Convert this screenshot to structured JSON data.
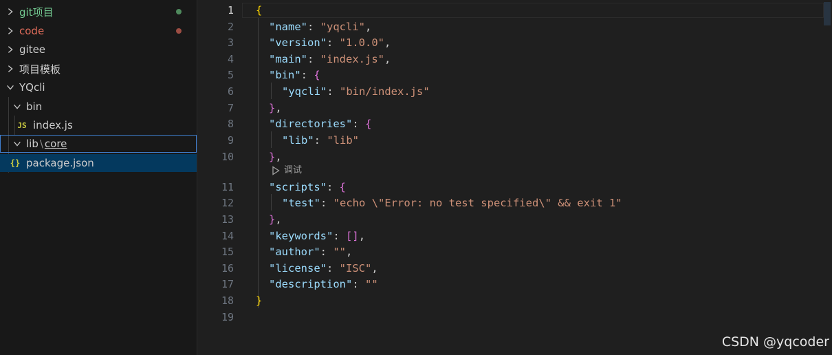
{
  "explorer": {
    "items": [
      {
        "label": "git项目",
        "color": "#73c991",
        "badge_color": "#4f8a5d",
        "expanded": false
      },
      {
        "label": "code",
        "color": "#e06c5a",
        "badge_color": "#9c4d43",
        "expanded": false
      },
      {
        "label": "gitee",
        "expanded": false
      },
      {
        "label": "项目模板",
        "expanded": false
      },
      {
        "label": "YQcli",
        "expanded": true
      },
      {
        "label": "bin",
        "expanded": true
      },
      {
        "label": "index.js",
        "icon": "JS"
      },
      {
        "label_left": "lib",
        "separator": "\\",
        "label_right": "core",
        "expanded": true
      },
      {
        "label": "package.json",
        "icon": "{}"
      }
    ]
  },
  "editor": {
    "line_numbers": [
      "1",
      "2",
      "3",
      "4",
      "5",
      "6",
      "7",
      "8",
      "9",
      "10",
      "11",
      "12",
      "13",
      "14",
      "15",
      "16",
      "17",
      "18",
      "19"
    ],
    "codelens": "调试",
    "lines": {
      "l1": {
        "open": "{"
      },
      "l2": {
        "key": "\"name\"",
        "colon": ": ",
        "value": "\"yqcli\"",
        "comma": ","
      },
      "l3": {
        "key": "\"version\"",
        "colon": ": ",
        "value": "\"1.0.0\"",
        "comma": ","
      },
      "l4": {
        "key": "\"main\"",
        "colon": ": ",
        "value": "\"index.js\"",
        "comma": ","
      },
      "l5": {
        "key": "\"bin\"",
        "colon": ": ",
        "open": "{"
      },
      "l6": {
        "key": "\"yqcli\"",
        "colon": ": ",
        "value": "\"bin/index.js\""
      },
      "l7": {
        "close": "}",
        "comma": ","
      },
      "l8": {
        "key": "\"directories\"",
        "colon": ": ",
        "open": "{"
      },
      "l9": {
        "key": "\"lib\"",
        "colon": ": ",
        "value": "\"lib\""
      },
      "l10": {
        "close": "}",
        "comma": ","
      },
      "l11": {
        "key": "\"scripts\"",
        "colon": ": ",
        "open": "{"
      },
      "l12": {
        "key": "\"test\"",
        "colon": ": ",
        "value": "\"echo \\\"Error: no test specified\\\" && exit 1\""
      },
      "l13": {
        "close": "}",
        "comma": ","
      },
      "l14": {
        "key": "\"keywords\"",
        "colon": ": ",
        "open": "[",
        "close": "]",
        "comma": ","
      },
      "l15": {
        "key": "\"author\"",
        "colon": ": ",
        "value": "\"\"",
        "comma": ","
      },
      "l16": {
        "key": "\"license\"",
        "colon": ": ",
        "value": "\"ISC\"",
        "comma": ","
      },
      "l17": {
        "key": "\"description\"",
        "colon": ": ",
        "value": "\"\""
      },
      "l18": {
        "close": "}"
      }
    }
  },
  "watermark": "CSDN @yqcoder"
}
